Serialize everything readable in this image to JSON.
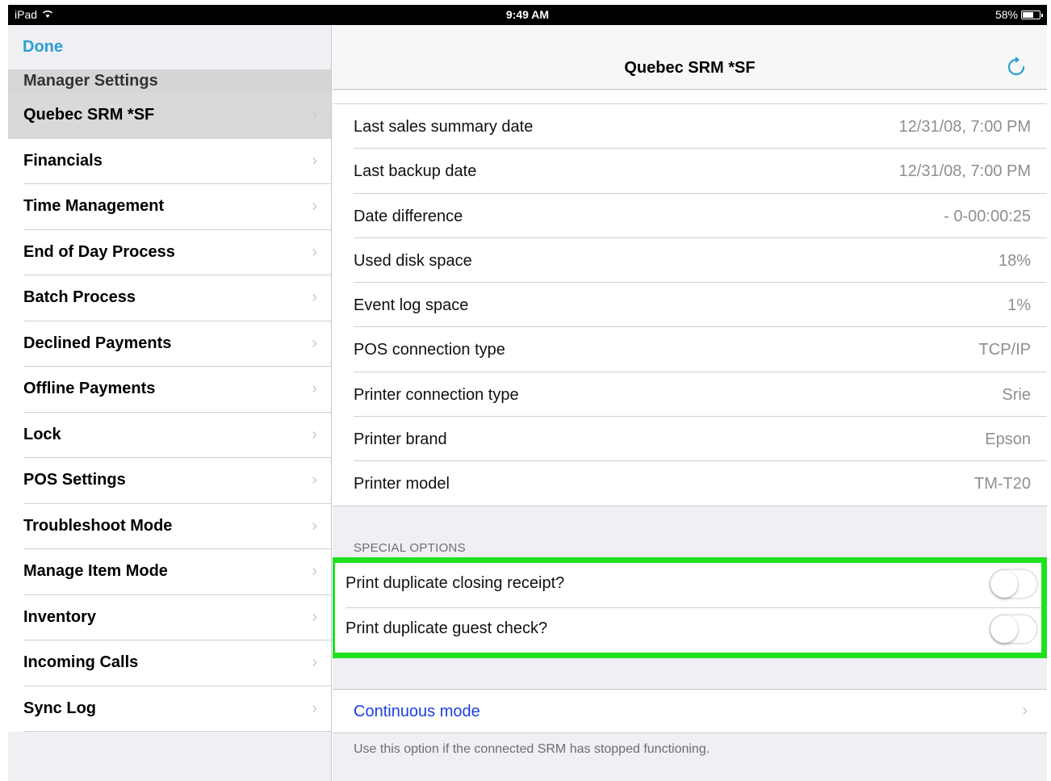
{
  "status_bar": {
    "device": "iPad",
    "time": "9:49 AM",
    "battery": "58%",
    "battery_level": 0.58
  },
  "sidebar": {
    "done_label": "Done",
    "header": "Manager Settings",
    "items": [
      {
        "label": "Quebec SRM *SF",
        "selected": true
      },
      {
        "label": "Financials"
      },
      {
        "label": "Time Management"
      },
      {
        "label": "End of Day Process"
      },
      {
        "label": "Batch Process"
      },
      {
        "label": "Declined Payments"
      },
      {
        "label": "Offline Payments"
      },
      {
        "label": "Lock"
      },
      {
        "label": "POS Settings"
      },
      {
        "label": "Troubleshoot Mode"
      },
      {
        "label": "Manage Item Mode"
      },
      {
        "label": "Inventory"
      },
      {
        "label": "Incoming Calls"
      },
      {
        "label": "Sync Log"
      }
    ]
  },
  "detail": {
    "title": "Quebec SRM *SF",
    "refresh_icon": "refresh-icon",
    "info_rows": [
      {
        "key": "Last sales summary date",
        "value": "12/31/08, 7:00 PM"
      },
      {
        "key": "Last backup date",
        "value": "12/31/08, 7:00 PM"
      },
      {
        "key": "Date difference",
        "value": "- 0-00:00:25"
      },
      {
        "key": "Used disk space",
        "value": "18%"
      },
      {
        "key": "Event log space",
        "value": "1%"
      },
      {
        "key": "POS connection type",
        "value": "TCP/IP"
      },
      {
        "key": "Printer connection type",
        "value": "Srie"
      },
      {
        "key": "Printer brand",
        "value": "Epson"
      },
      {
        "key": "Printer model",
        "value": "TM-T20"
      }
    ],
    "special_options_header": "SPECIAL OPTIONS",
    "special_options": [
      {
        "label": "Print duplicate closing receipt?",
        "on": false
      },
      {
        "label": "Print duplicate guest check?",
        "on": false
      }
    ],
    "continuous_mode_label": "Continuous mode",
    "footer_note": "Use this option if the connected SRM has stopped functioning."
  },
  "colors": {
    "accent": "#2a9fd6",
    "link": "#1a3fe0",
    "highlight": "#1fe21f"
  }
}
